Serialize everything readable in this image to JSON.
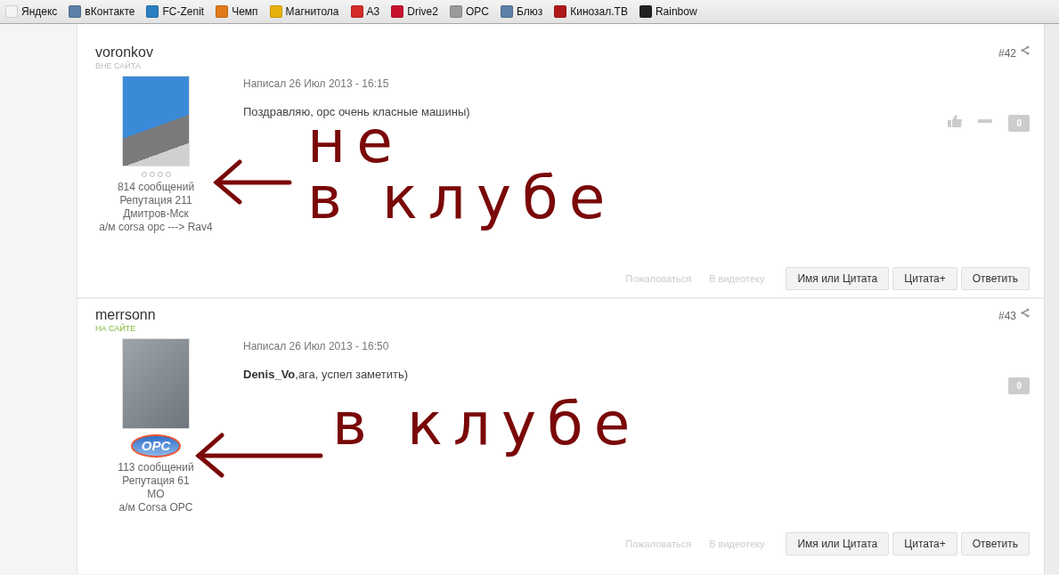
{
  "bookmarks": [
    {
      "label": "Яндекс",
      "color": "#f4f4f4"
    },
    {
      "label": "вКонтакте",
      "color": "#5b7fa6"
    },
    {
      "label": "FC-Zenit",
      "color": "#2a7fc1"
    },
    {
      "label": "Чемп",
      "color": "#e07a1a"
    },
    {
      "label": "Магнитола",
      "color": "#e8b20c"
    },
    {
      "label": "A3",
      "color": "#d42a2a"
    },
    {
      "label": "Drive2",
      "color": "#c8102e"
    },
    {
      "label": "OPC",
      "color": "#9a9a9a"
    },
    {
      "label": "Блюз",
      "color": "#5b7fa6"
    },
    {
      "label": "Кинозал.ТВ",
      "color": "#b01818"
    },
    {
      "label": "Rainbow",
      "color": "#222222"
    }
  ],
  "posts": [
    {
      "number": "#42",
      "author": "voronkov",
      "online": false,
      "status": "ВНЕ САЙТА",
      "avatar": {
        "kind": "car"
      },
      "badge": {
        "kind": "pips"
      },
      "stats": [
        "814 сообщений",
        "Репутация 211",
        "Дмитров-Мск",
        "а/м corsa opc ---> Rav4"
      ],
      "date": "Написал 26 Июл 2013 - 16:15",
      "message": "Поздравляю, opc очень класные машины)",
      "rating_controls": true,
      "rating": "0",
      "links": [
        "Пожаловаться",
        "В видеотеку"
      ],
      "buttons": [
        "Имя или Цитата",
        "Цитата+",
        "Ответить"
      ],
      "annotation": [
        "не",
        "в клубе"
      ]
    },
    {
      "number": "#43",
      "author": "merrsonn",
      "online": true,
      "status": "НА САЙТЕ",
      "avatar": {
        "kind": "robot"
      },
      "badge": {
        "kind": "logo",
        "text": "OPC"
      },
      "stats": [
        "113 сообщений",
        "Репутация 61",
        "МО",
        "а/м Corsa OPC"
      ],
      "date": "Написал 26 Июл 2013 - 16:50",
      "message": "**Denis_Vo**,ага, успел заметить)",
      "rating_controls": false,
      "rating": "0",
      "links": [
        "Пожаловаться",
        "В видеотеку"
      ],
      "buttons": [
        "Имя или Цитата",
        "Цитата+",
        "Ответить"
      ],
      "annotation": [
        "в клубе"
      ]
    }
  ]
}
